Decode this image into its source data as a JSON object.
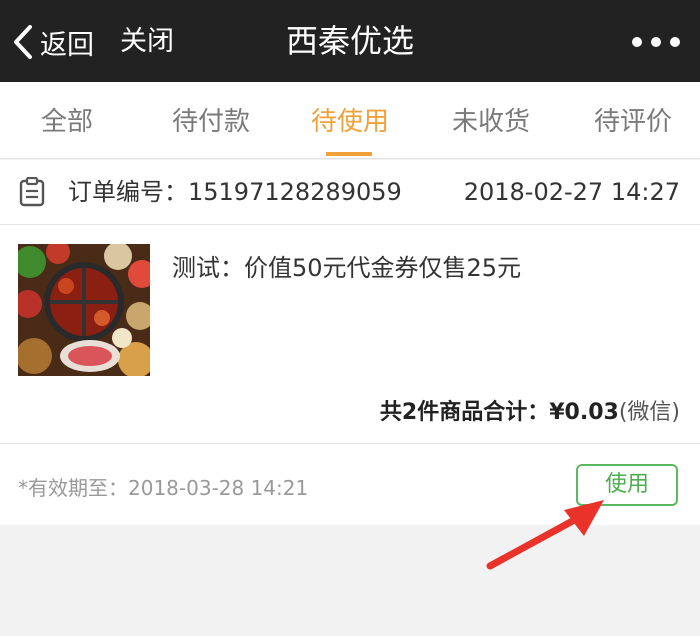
{
  "header": {
    "back_label": "返回",
    "close_label": "关闭",
    "title": "西秦优选",
    "more_icon": "more-dots-icon"
  },
  "tabs": [
    {
      "label": "全部",
      "active": false
    },
    {
      "label": "待付款",
      "active": false
    },
    {
      "label": "待使用",
      "active": true
    },
    {
      "label": "未收货",
      "active": false
    },
    {
      "label": "待评价",
      "active": false
    }
  ],
  "order": {
    "number_label": "订单编号：",
    "number": "15197128289059",
    "date": "2018-02-27 14:27",
    "product_name": "测试：价值50元代金券仅售25元",
    "total_text": "共2件商品合计：¥0.03",
    "pay_method": "(微信)",
    "valid_until": "*有效期至：2018-03-28 14:21",
    "use_label": "使用"
  },
  "colors": {
    "topbar": "#222222",
    "accent": "#f0a13a",
    "use_button": "#5cb85c",
    "arrow": "#e8322a"
  }
}
